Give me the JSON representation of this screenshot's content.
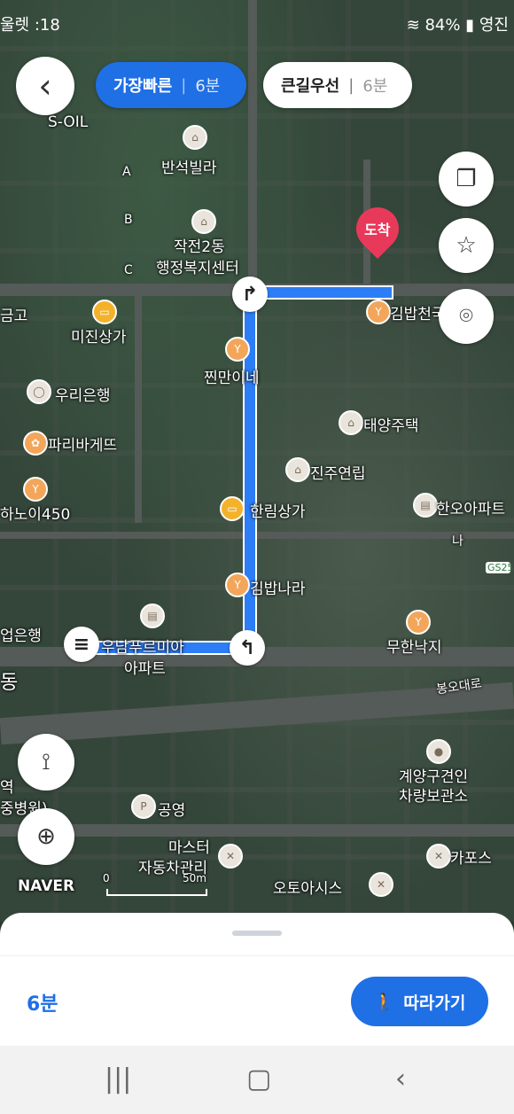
{
  "statusbar": {
    "left": "울렛 :18",
    "battery": "84%",
    "right_text": "영진"
  },
  "route_tabs": [
    {
      "label": "가장빠른",
      "time": "6분",
      "active": true
    },
    {
      "label": "큰길우선",
      "time": "6분",
      "active": false
    }
  ],
  "destination_label": "도착",
  "map_labels": {
    "soil": "S-OIL",
    "banseok": "반석빌라",
    "jakjeon": "작전2동",
    "admin_center": "행정복지센터",
    "geumgo": "금고",
    "mijin": "미진상가",
    "jjinmani": "찐만이네",
    "woori": "우리은행",
    "paris": "파리바게뜨",
    "hanoi": "하노이450",
    "taeyang": "태양주택",
    "jinju": "진주연립",
    "hallim": "한림상가",
    "hanoa": "한오아파트",
    "gimbap_top": "김밥천국",
    "gimbap_nara": "김밥나라",
    "upbank": "업은행",
    "unam": "우남푸르미아",
    "apt": "아파트",
    "muhan": "무한낙지",
    "bongo": "봉오대로",
    "gyeyang1": "계양구견인",
    "gyeyang2": "차량보관소",
    "gongyeong": "공영",
    "master1": "마스터",
    "master2": "자동차관리",
    "kapos": "카포스",
    "oto": "오토아시스",
    "naver": "NAVER",
    "scale_zero": "0",
    "scale_50": "50m",
    "letter_a": "A",
    "letter_b": "B",
    "letter_c": "C",
    "letter_na": "나",
    "dong": "동",
    "yeok": "역",
    "byeongwon": "중병원)",
    "gs25": "GS25"
  },
  "bottom_sheet": {
    "eta": "6분",
    "follow_label": "따라가기"
  },
  "colors": {
    "accent": "#1f6fe5",
    "route": "#2d7df6",
    "destination": "#e8395a"
  },
  "icons": {
    "back": "chevron-left-icon",
    "layers": "layers-icon",
    "favorite": "star-icon",
    "location": "map-pin-icon",
    "route_options": "route-icon",
    "current_location": "crosshair-icon",
    "walker": "walking-person-icon"
  }
}
